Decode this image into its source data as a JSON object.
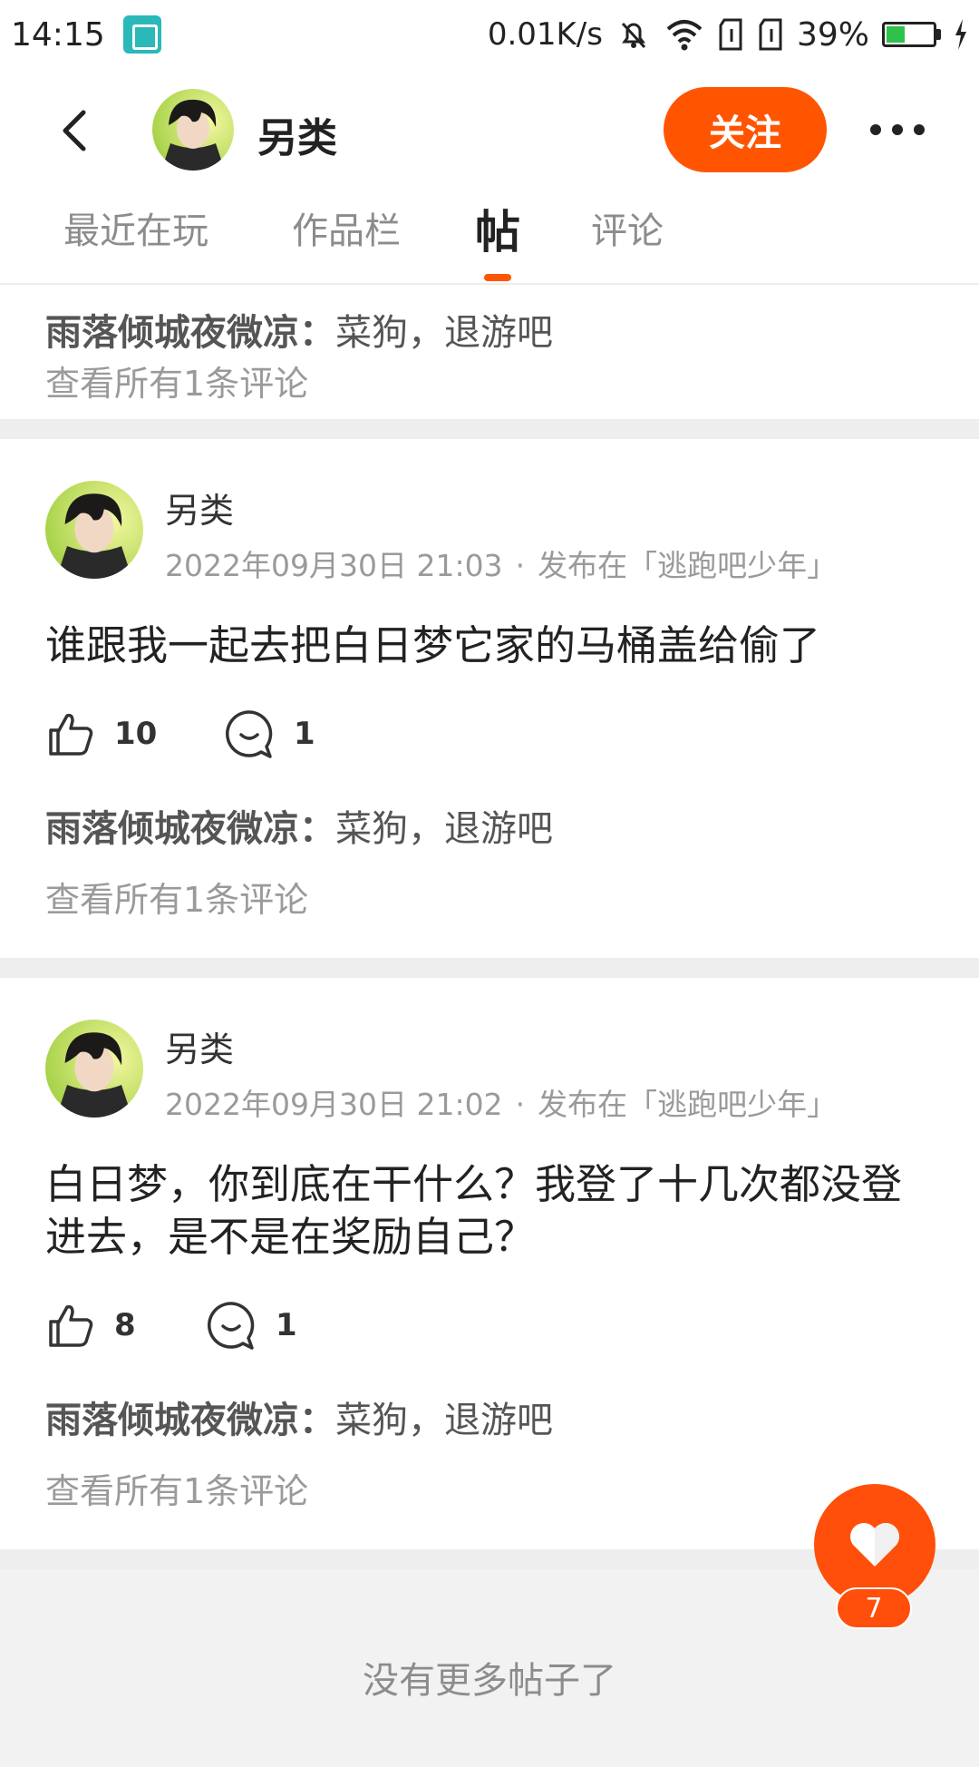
{
  "status_bar": {
    "time": "14:15",
    "net_speed": "0.01K/s",
    "battery_percent": "39%",
    "battery_level": 0.39,
    "icons": [
      "screenshot-icon",
      "bell-off-icon",
      "wifi-icon",
      "sim1-icon",
      "sim2-icon",
      "battery-icon",
      "charging-icon"
    ]
  },
  "header": {
    "name": "另类",
    "follow_label": "关注"
  },
  "tabs": [
    {
      "label": "最近在玩"
    },
    {
      "label": "作品栏"
    },
    {
      "label": "帖"
    },
    {
      "label": "评论"
    }
  ],
  "partial_post": {
    "reply_name": "雨落倾城夜微凉",
    "reply_sep": "：",
    "reply_text": "菜狗，退游吧",
    "view_all": "查看所有1条评论"
  },
  "posts": [
    {
      "author": "另类",
      "time": "2022年09月30日 21:03",
      "dot": "·",
      "posted_in": "发布在「逃跑吧少年」",
      "content": "谁跟我一起去把白日梦它家的马桶盖给偷了",
      "likes": "10",
      "comments": "1",
      "reply_name": "雨落倾城夜微凉",
      "reply_sep": "：",
      "reply_text": "菜狗，退游吧",
      "view_all": "查看所有1条评论"
    },
    {
      "author": "另类",
      "time": "2022年09月30日 21:02",
      "dot": "·",
      "posted_in": "发布在「逃跑吧少年」",
      "content": "白日梦，你到底在干什么？我登了十几次都没登进去，是不是在奖励自己？",
      "likes": "8",
      "comments": "1",
      "reply_name": "雨落倾城夜微凉",
      "reply_sep": "：",
      "reply_text": "菜狗，退游吧",
      "view_all": "查看所有1条评论"
    }
  ],
  "footer": {
    "no_more": "没有更多帖子了"
  },
  "fab": {
    "count": "7"
  },
  "colors": {
    "accent": "#ff5500",
    "muted": "#9a9a9a",
    "separator": "#eeeeee"
  }
}
